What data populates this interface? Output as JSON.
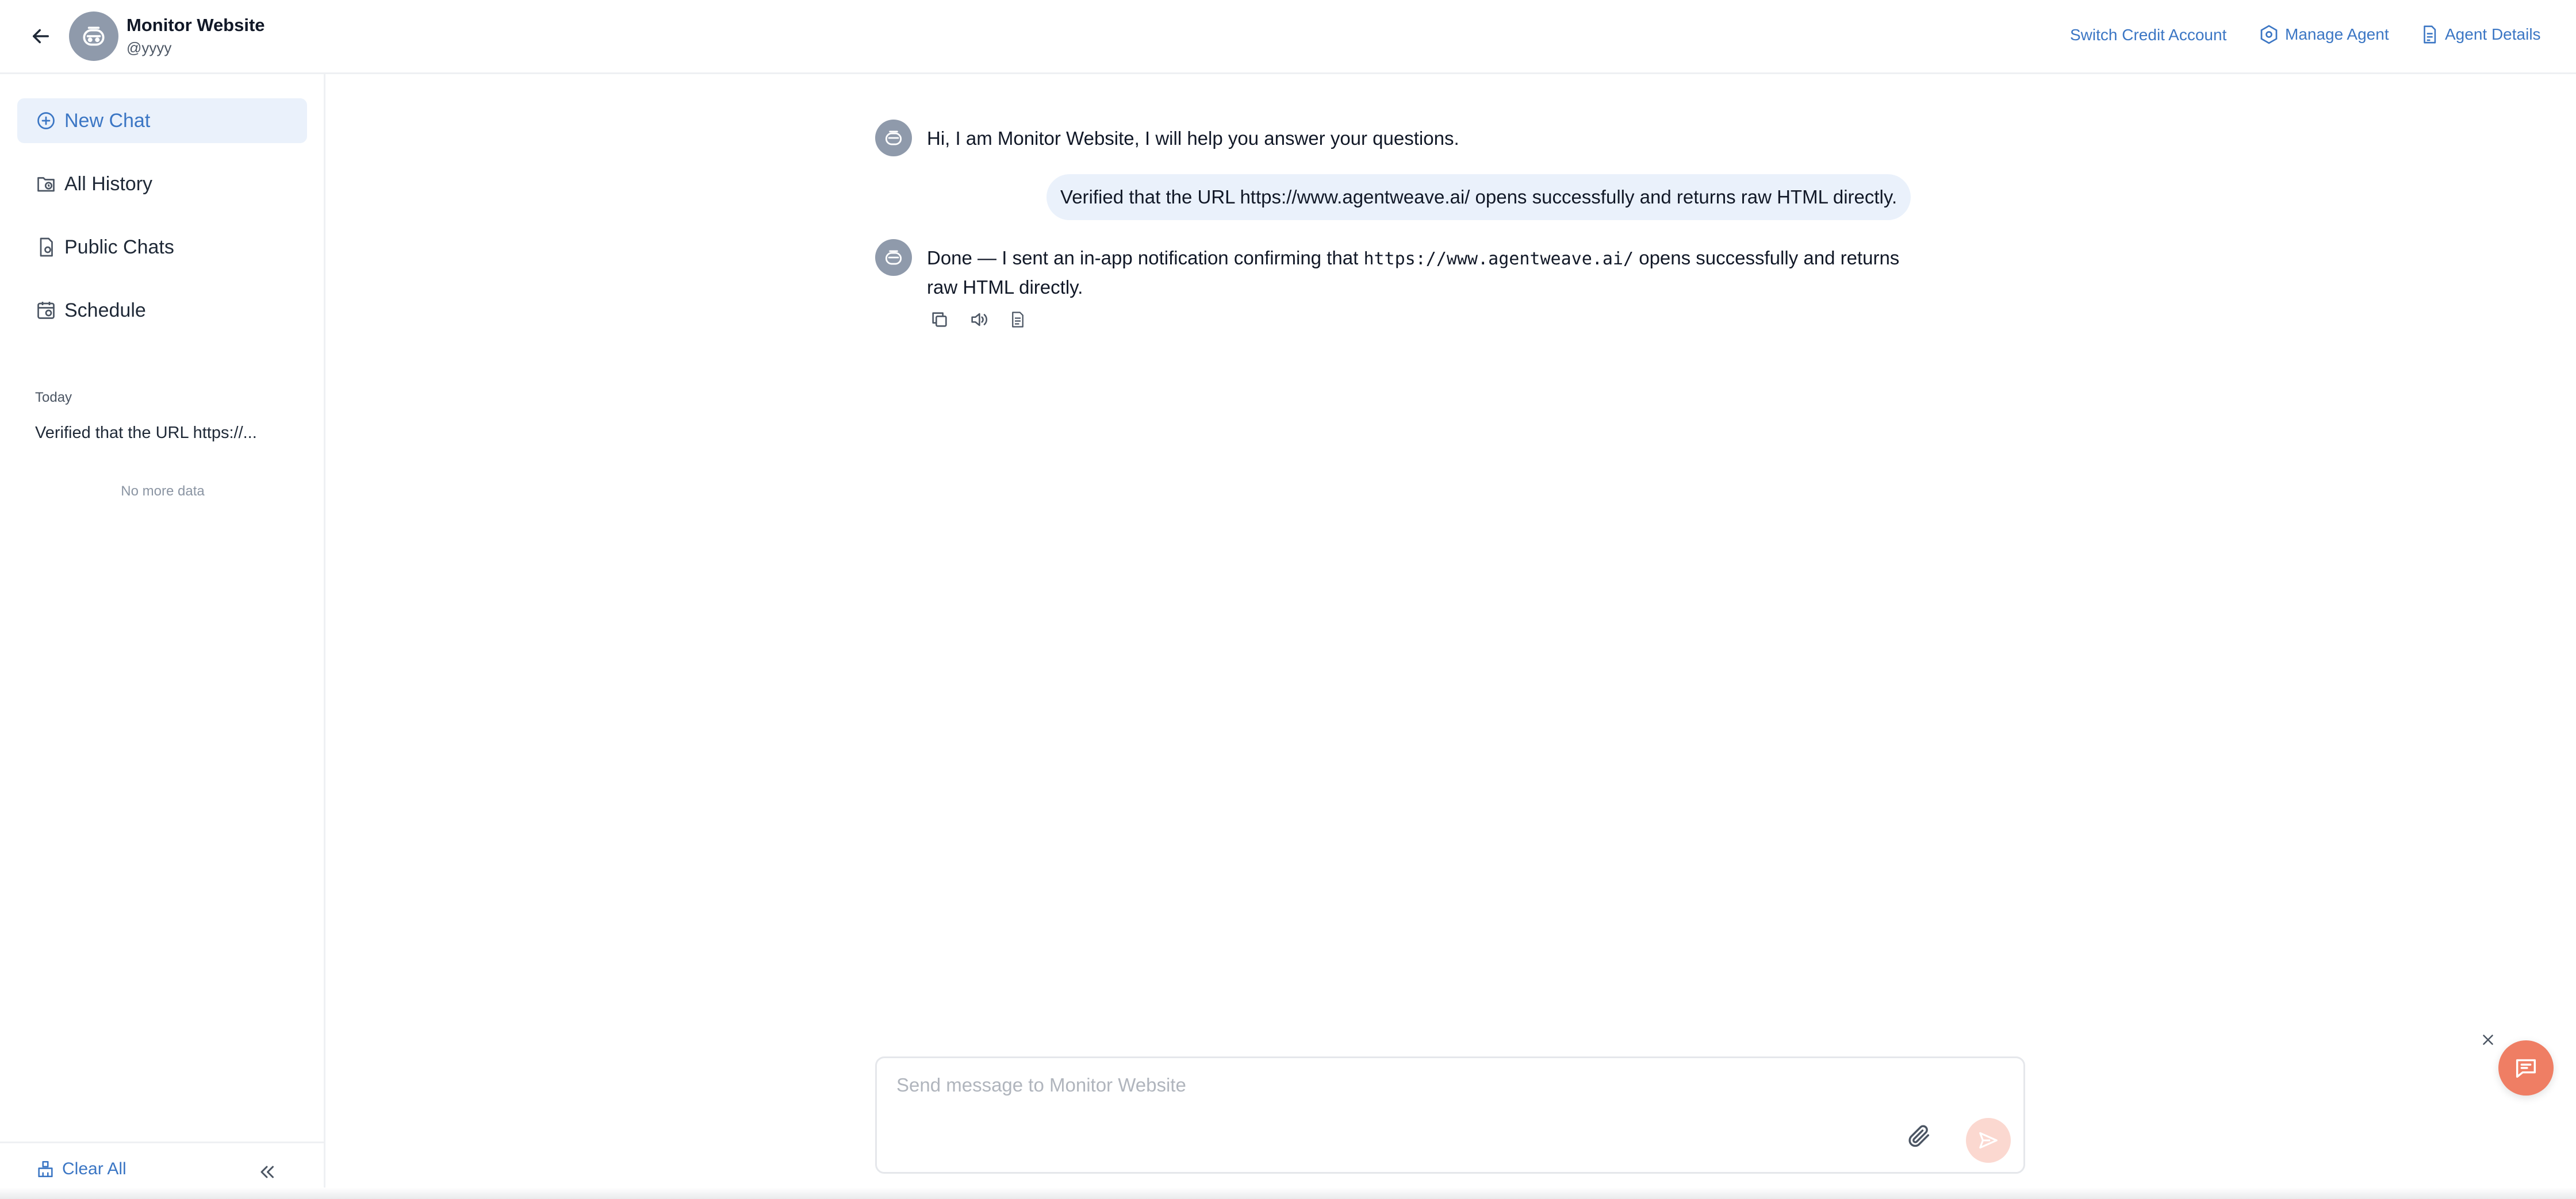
{
  "header": {
    "agent_name": "Monitor Website",
    "agent_handle": "@yyyy",
    "actions": {
      "switch_credit": "Switch Credit Account",
      "manage_agent": "Manage Agent",
      "agent_details": "Agent Details"
    }
  },
  "sidebar": {
    "nav": [
      {
        "label": "New Chat",
        "icon": "plus-circle-icon",
        "active": true
      },
      {
        "label": "All History",
        "icon": "history-folder-icon"
      },
      {
        "label": "Public Chats",
        "icon": "public-doc-icon"
      },
      {
        "label": "Schedule",
        "icon": "calendar-icon"
      }
    ],
    "section_today": "Today",
    "history": [
      "Verified that the URL https://..."
    ],
    "no_more": "No more data",
    "clear_all": "Clear All"
  },
  "chat": {
    "greeting": "Hi, I am Monitor Website, I will help you answer your questions.",
    "user_message": "Verified that the URL https://www.agentweave.ai/ opens successfully and returns raw HTML directly.",
    "bot_reply_prefix": "Done — I sent an in-app notification confirming that",
    "bot_reply_code": "https://www.agentweave.ai/",
    "bot_reply_suffix": "opens successfully and returns",
    "bot_reply_line2": "raw HTML directly."
  },
  "composer": {
    "placeholder": "Send message to Monitor Website",
    "value": ""
  },
  "colors": {
    "accent": "#3b76c4",
    "active_bg": "#eaf1fb",
    "widget": "#ef7e64",
    "send_disabled": "#fbd8d0"
  }
}
